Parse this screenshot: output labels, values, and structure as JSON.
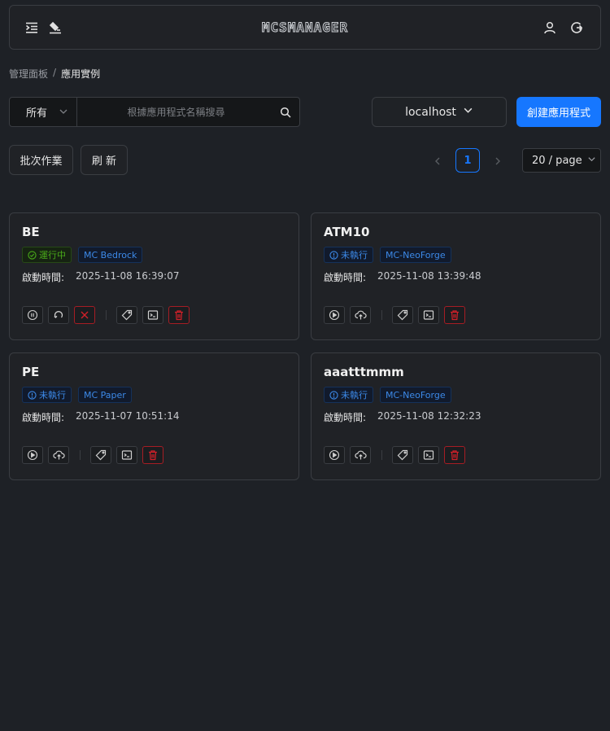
{
  "header": {
    "logo": "MCSMANAGER",
    "icons": [
      "menu-indent-icon",
      "clear-format-icon",
      "user-icon",
      "logout-icon"
    ]
  },
  "breadcrumb": {
    "parent": "管理面板",
    "separator": "/",
    "current": "應用實例"
  },
  "filter": {
    "status_select": "所有",
    "search_placeholder": "根據應用程式名稱搜尋"
  },
  "node_select": {
    "value": "localhost"
  },
  "create_button": "創建應用程式",
  "batch_button": "批次作業",
  "refresh_button": "刷 新",
  "pagination": {
    "current": "1",
    "page_size": "20 / page"
  },
  "start_time_label": "啟動時間:",
  "colors": {
    "accent": "#1677ff",
    "running": "#49aa19",
    "danger": "#d32029",
    "background": "#1e2126"
  },
  "instances": [
    {
      "name": "BE",
      "status": "運行中",
      "status_kind": "running",
      "type": "MC Bedrock",
      "start_time": "2025-11-08 16:39:07"
    },
    {
      "name": "ATM10",
      "status": "未執行",
      "status_kind": "stopped",
      "type": "MC-NeoForge",
      "start_time": "2025-11-08 13:39:48"
    },
    {
      "name": "PE",
      "status": "未執行",
      "status_kind": "stopped",
      "type": "MC Paper",
      "start_time": "2025-11-07 10:51:14"
    },
    {
      "name": "aaatttmmm",
      "status": "未執行",
      "status_kind": "stopped",
      "type": "MC-NeoForge",
      "start_time": "2025-11-08 12:32:23"
    }
  ]
}
